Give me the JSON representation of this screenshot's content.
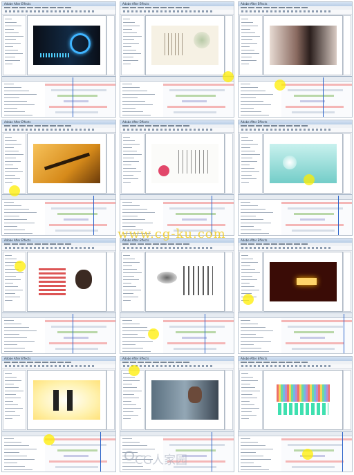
{
  "tiles": [
    {
      "title": "Adobe After Effects",
      "theme": "dark-blue-logo"
    },
    {
      "title": "Adobe After Effects",
      "theme": "ink-floral"
    },
    {
      "title": "Adobe After Effects",
      "theme": "photo-portrait"
    },
    {
      "title": "Adobe After Effects",
      "theme": "fountain-pen"
    },
    {
      "title": "Adobe After Effects",
      "theme": "chinese-poem"
    },
    {
      "title": "Adobe After Effects",
      "theme": "teal-floral"
    },
    {
      "title": "Adobe After Effects",
      "theme": "red-character"
    },
    {
      "title": "Adobe After Effects",
      "theme": "calligraphy-ink"
    },
    {
      "title": "Adobe After Effects",
      "theme": "glow-text-dark"
    },
    {
      "title": "Adobe After Effects",
      "theme": "figures-light"
    },
    {
      "title": "Adobe After Effects",
      "theme": "car-video"
    },
    {
      "title": "Adobe After Effects",
      "theme": "colorful-equalizer"
    }
  ],
  "watermarks": {
    "site": "www.cg-ku.com",
    "brand": "CG人家园"
  },
  "colors": {
    "highlight": "#ffee00",
    "watermark_site": "#f3ce28",
    "panel_border": "#b9c3cf"
  }
}
